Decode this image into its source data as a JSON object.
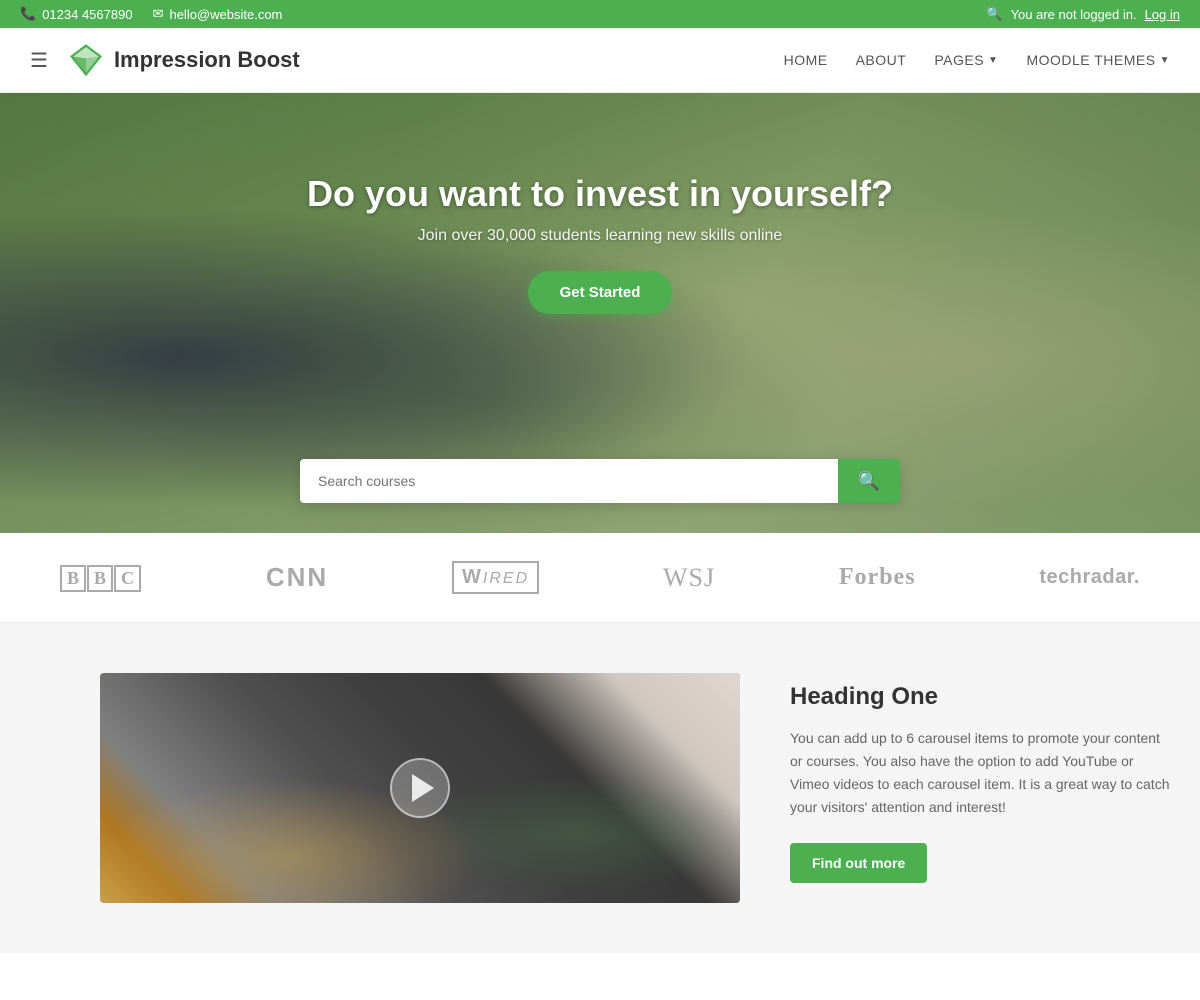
{
  "topbar": {
    "phone": "01234 4567890",
    "email": "hello@website.com",
    "login_text": "You are not logged in.",
    "login_link": "Log in"
  },
  "header": {
    "site_name": "Impression Boost",
    "nav": {
      "home": "HOME",
      "about": "ABOUT",
      "pages": "PAGES",
      "moodle_themes": "MOODLE THEMES"
    }
  },
  "hero": {
    "heading": "Do you want to invest in yourself?",
    "subheading": "Join over 30,000 students learning new skills online",
    "cta_label": "Get Started",
    "search_placeholder": "Search courses"
  },
  "logos": [
    {
      "name": "bbc",
      "label": "BBC"
    },
    {
      "name": "cnn",
      "label": "CNN"
    },
    {
      "name": "wired",
      "label": "WIRED"
    },
    {
      "name": "wsj",
      "label": "WSJ"
    },
    {
      "name": "forbes",
      "label": "Forbes"
    },
    {
      "name": "techradar",
      "label": "techradar."
    }
  ],
  "content": {
    "heading": "Heading One",
    "body": "You can add up to 6 carousel items to promote your content or courses. You also have the option to add YouTube or Vimeo videos to each carousel item. It is a great way to catch your visitors' attention and interest!",
    "cta_label": "Find out more"
  }
}
